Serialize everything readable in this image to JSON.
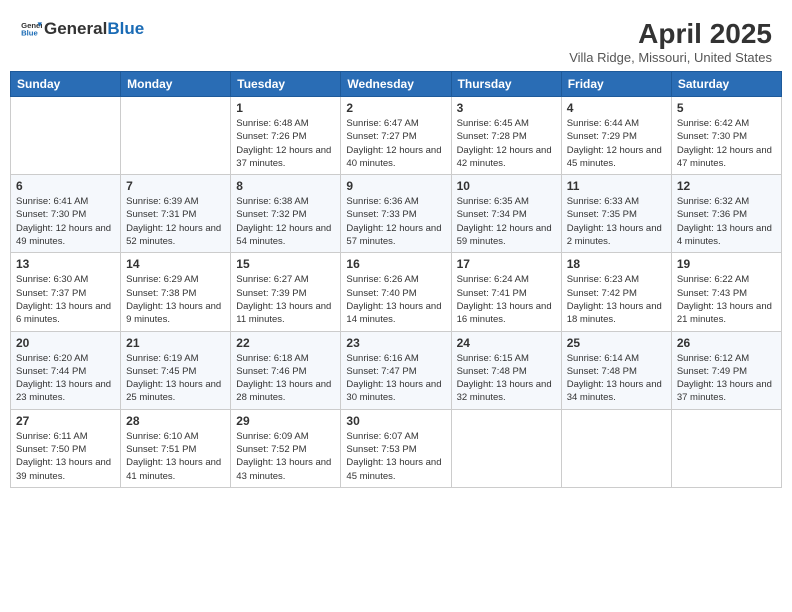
{
  "header": {
    "logo_general": "General",
    "logo_blue": "Blue",
    "month": "April 2025",
    "location": "Villa Ridge, Missouri, United States"
  },
  "weekdays": [
    "Sunday",
    "Monday",
    "Tuesday",
    "Wednesday",
    "Thursday",
    "Friday",
    "Saturday"
  ],
  "weeks": [
    [
      {
        "day": "",
        "info": ""
      },
      {
        "day": "",
        "info": ""
      },
      {
        "day": "1",
        "info": "Sunrise: 6:48 AM\nSunset: 7:26 PM\nDaylight: 12 hours and 37 minutes."
      },
      {
        "day": "2",
        "info": "Sunrise: 6:47 AM\nSunset: 7:27 PM\nDaylight: 12 hours and 40 minutes."
      },
      {
        "day": "3",
        "info": "Sunrise: 6:45 AM\nSunset: 7:28 PM\nDaylight: 12 hours and 42 minutes."
      },
      {
        "day": "4",
        "info": "Sunrise: 6:44 AM\nSunset: 7:29 PM\nDaylight: 12 hours and 45 minutes."
      },
      {
        "day": "5",
        "info": "Sunrise: 6:42 AM\nSunset: 7:30 PM\nDaylight: 12 hours and 47 minutes."
      }
    ],
    [
      {
        "day": "6",
        "info": "Sunrise: 6:41 AM\nSunset: 7:30 PM\nDaylight: 12 hours and 49 minutes."
      },
      {
        "day": "7",
        "info": "Sunrise: 6:39 AM\nSunset: 7:31 PM\nDaylight: 12 hours and 52 minutes."
      },
      {
        "day": "8",
        "info": "Sunrise: 6:38 AM\nSunset: 7:32 PM\nDaylight: 12 hours and 54 minutes."
      },
      {
        "day": "9",
        "info": "Sunrise: 6:36 AM\nSunset: 7:33 PM\nDaylight: 12 hours and 57 minutes."
      },
      {
        "day": "10",
        "info": "Sunrise: 6:35 AM\nSunset: 7:34 PM\nDaylight: 12 hours and 59 minutes."
      },
      {
        "day": "11",
        "info": "Sunrise: 6:33 AM\nSunset: 7:35 PM\nDaylight: 13 hours and 2 minutes."
      },
      {
        "day": "12",
        "info": "Sunrise: 6:32 AM\nSunset: 7:36 PM\nDaylight: 13 hours and 4 minutes."
      }
    ],
    [
      {
        "day": "13",
        "info": "Sunrise: 6:30 AM\nSunset: 7:37 PM\nDaylight: 13 hours and 6 minutes."
      },
      {
        "day": "14",
        "info": "Sunrise: 6:29 AM\nSunset: 7:38 PM\nDaylight: 13 hours and 9 minutes."
      },
      {
        "day": "15",
        "info": "Sunrise: 6:27 AM\nSunset: 7:39 PM\nDaylight: 13 hours and 11 minutes."
      },
      {
        "day": "16",
        "info": "Sunrise: 6:26 AM\nSunset: 7:40 PM\nDaylight: 13 hours and 14 minutes."
      },
      {
        "day": "17",
        "info": "Sunrise: 6:24 AM\nSunset: 7:41 PM\nDaylight: 13 hours and 16 minutes."
      },
      {
        "day": "18",
        "info": "Sunrise: 6:23 AM\nSunset: 7:42 PM\nDaylight: 13 hours and 18 minutes."
      },
      {
        "day": "19",
        "info": "Sunrise: 6:22 AM\nSunset: 7:43 PM\nDaylight: 13 hours and 21 minutes."
      }
    ],
    [
      {
        "day": "20",
        "info": "Sunrise: 6:20 AM\nSunset: 7:44 PM\nDaylight: 13 hours and 23 minutes."
      },
      {
        "day": "21",
        "info": "Sunrise: 6:19 AM\nSunset: 7:45 PM\nDaylight: 13 hours and 25 minutes."
      },
      {
        "day": "22",
        "info": "Sunrise: 6:18 AM\nSunset: 7:46 PM\nDaylight: 13 hours and 28 minutes."
      },
      {
        "day": "23",
        "info": "Sunrise: 6:16 AM\nSunset: 7:47 PM\nDaylight: 13 hours and 30 minutes."
      },
      {
        "day": "24",
        "info": "Sunrise: 6:15 AM\nSunset: 7:48 PM\nDaylight: 13 hours and 32 minutes."
      },
      {
        "day": "25",
        "info": "Sunrise: 6:14 AM\nSunset: 7:48 PM\nDaylight: 13 hours and 34 minutes."
      },
      {
        "day": "26",
        "info": "Sunrise: 6:12 AM\nSunset: 7:49 PM\nDaylight: 13 hours and 37 minutes."
      }
    ],
    [
      {
        "day": "27",
        "info": "Sunrise: 6:11 AM\nSunset: 7:50 PM\nDaylight: 13 hours and 39 minutes."
      },
      {
        "day": "28",
        "info": "Sunrise: 6:10 AM\nSunset: 7:51 PM\nDaylight: 13 hours and 41 minutes."
      },
      {
        "day": "29",
        "info": "Sunrise: 6:09 AM\nSunset: 7:52 PM\nDaylight: 13 hours and 43 minutes."
      },
      {
        "day": "30",
        "info": "Sunrise: 6:07 AM\nSunset: 7:53 PM\nDaylight: 13 hours and 45 minutes."
      },
      {
        "day": "",
        "info": ""
      },
      {
        "day": "",
        "info": ""
      },
      {
        "day": "",
        "info": ""
      }
    ]
  ]
}
